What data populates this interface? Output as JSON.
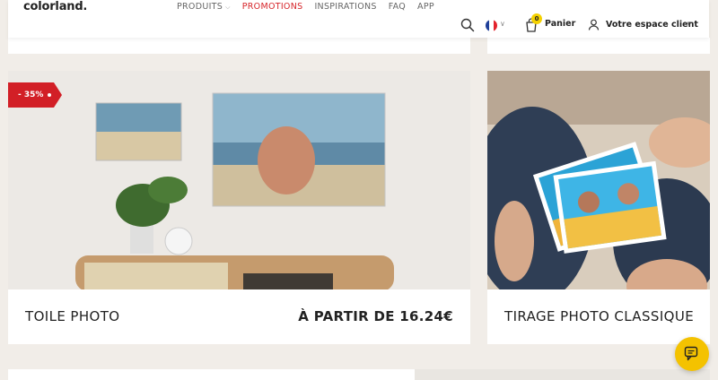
{
  "brand": {
    "logo_text": "colorland."
  },
  "nav": {
    "items": [
      {
        "label": "PRODUITS",
        "has_dropdown": true
      },
      {
        "label": "PROMOTIONS",
        "active": true,
        "color": "#d6252a"
      },
      {
        "label": "INSPIRATIONS"
      },
      {
        "label": "FAQ"
      },
      {
        "label": "APP"
      }
    ]
  },
  "header": {
    "language_icon": "france-flag-icon",
    "cart_count": "0",
    "cart_label": "Panier",
    "account_label": "Votre espace client"
  },
  "products": [
    {
      "title": "TOILE PHOTO",
      "price": "À PARTIR DE 16.24€",
      "discount_badge": "- 35%"
    },
    {
      "title": "TIRAGE PHOTO CLASSIQUE"
    }
  ],
  "colors": {
    "page_bg": "#f1ede8",
    "accent_red": "#d21f26",
    "cart_badge": "#f4d100",
    "chat_button": "#f4c200"
  }
}
